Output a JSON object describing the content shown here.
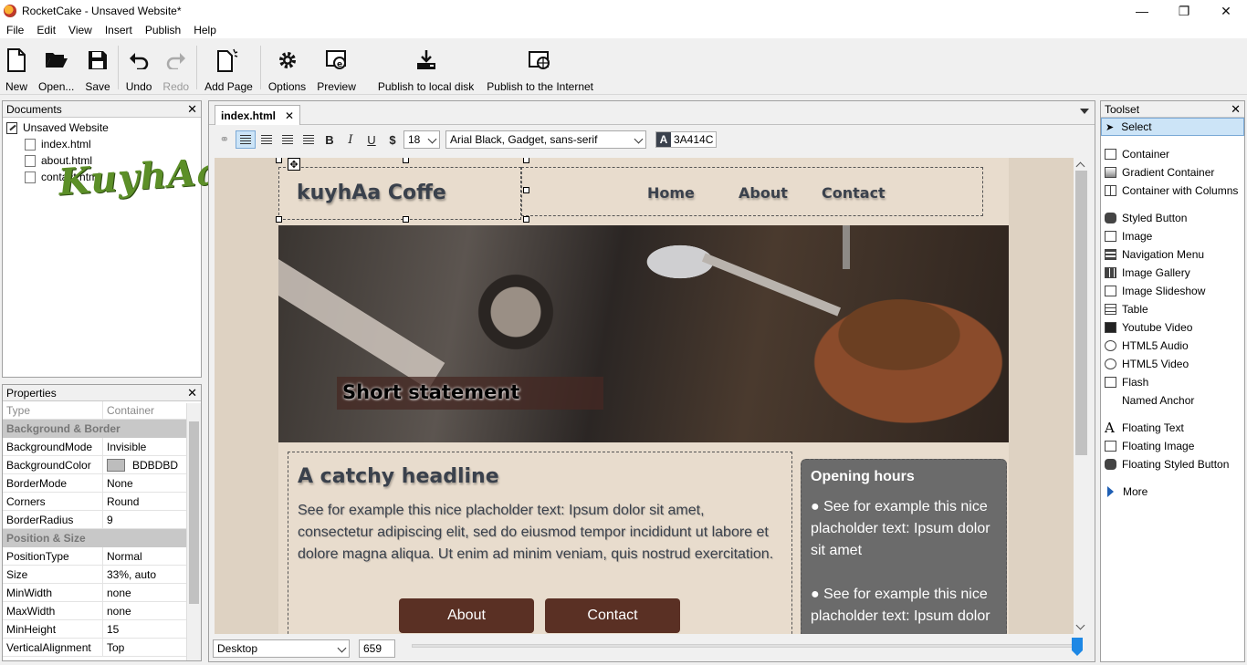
{
  "window": {
    "title": "RocketCake - Unsaved Website*",
    "controls": [
      "—",
      "❐",
      "✕"
    ]
  },
  "menu": [
    "File",
    "Edit",
    "View",
    "Insert",
    "Publish",
    "Help"
  ],
  "toolbar": {
    "new": "New",
    "open": "Open...",
    "save": "Save",
    "undo": "Undo",
    "redo": "Redo",
    "add_page": "Add Page",
    "options": "Options",
    "preview": "Preview",
    "publish_local": "Publish to local disk",
    "publish_internet": "Publish to the Internet"
  },
  "documents": {
    "title": "Documents",
    "root": "Unsaved Website",
    "files": [
      "index.html",
      "about.html",
      "contact.html"
    ],
    "watermark": "KuyhAaMe"
  },
  "properties": {
    "title": "Properties",
    "type_key": "Type",
    "type_value": "Container",
    "cat_bg": "Background & Border",
    "bg_rows": [
      {
        "k": "BackgroundMode",
        "v": "Invisible"
      },
      {
        "k": "BackgroundColor",
        "v": "BDBDBD"
      },
      {
        "k": "BorderMode",
        "v": "None"
      },
      {
        "k": "Corners",
        "v": "Round"
      },
      {
        "k": "BorderRadius",
        "v": "9"
      }
    ],
    "cat_pos": "Position & Size",
    "pos_rows": [
      {
        "k": "PositionType",
        "v": "Normal"
      },
      {
        "k": "Size",
        "v": "33%, auto"
      },
      {
        "k": "MinWidth",
        "v": "none"
      },
      {
        "k": "MaxWidth",
        "v": "none"
      },
      {
        "k": "MinHeight",
        "v": "15"
      },
      {
        "k": "VerticalAlignment",
        "v": "Top"
      }
    ],
    "swatch_color": "#bdbdbd"
  },
  "editor": {
    "tab": "index.html",
    "font_size": "18",
    "font_family": "Arial Black, Gadget, sans-serif",
    "text_color_label": "A",
    "text_color": "3A414C",
    "device": "Desktop",
    "width": "659"
  },
  "site": {
    "logo": "kuyhAa Coffe",
    "nav": [
      "Home",
      "About",
      "Contact"
    ],
    "statement": "Short statement",
    "headline": "A catchy headline",
    "body": "See for example this nice placholder text: Ipsum dolor sit amet, consectetur adipiscing elit, sed do eiusmod tempor incididunt ut labore et dolore magna aliqua. Ut enim ad minim veniam, quis nostrud exercitation.",
    "button_about": "About",
    "button_contact": "Contact",
    "sidebar_title": "Opening hours",
    "sidebar_items": [
      "● See for example this nice placholder text: Ipsum dolor sit amet",
      "● See for example this nice placholder text: Ipsum dolor"
    ],
    "colors": {
      "text": "#3a414c",
      "button": "#5a3024",
      "sidebar": "#6b6b6b",
      "page_bg": "#e8dccd"
    }
  },
  "toolset": {
    "title": "Toolset",
    "select": "Select",
    "groups": [
      [
        "Container",
        "Gradient Container",
        "Container with Columns"
      ],
      [
        "Styled Button",
        "Image",
        "Navigation Menu",
        "Image Gallery",
        "Image Slideshow",
        "Table",
        "Youtube Video",
        "HTML5 Audio",
        "HTML5 Video",
        "Flash",
        "Named Anchor"
      ],
      [
        "Floating Text",
        "Floating Image",
        "Floating Styled Button"
      ],
      [
        "More"
      ]
    ]
  }
}
